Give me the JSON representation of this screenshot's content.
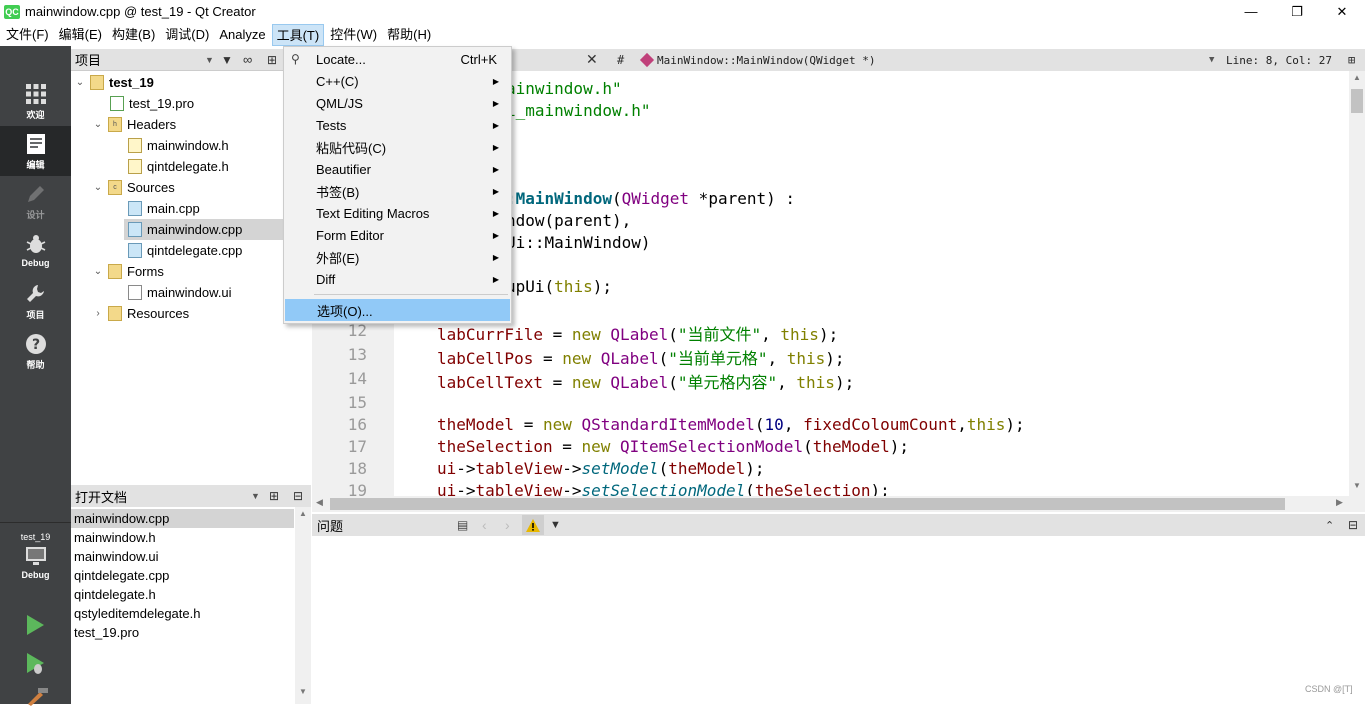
{
  "window": {
    "title": "mainwindow.cpp @ test_19 - Qt Creator",
    "app_icon": "QC"
  },
  "menubar": [
    "文件(F)",
    "编辑(E)",
    "构建(B)",
    "调试(D)",
    "Analyze",
    "工具(T)",
    "控件(W)",
    "帮助(H)"
  ],
  "modes": [
    {
      "label": "欢迎",
      "icon": "grid-icon"
    },
    {
      "label": "编辑",
      "icon": "edit-icon"
    },
    {
      "label": "设计",
      "icon": "pencil-icon"
    },
    {
      "label": "Debug",
      "icon": "bug-icon"
    },
    {
      "label": "项目",
      "icon": "wrench-icon"
    },
    {
      "label": "帮助",
      "icon": "help-icon"
    }
  ],
  "kit": {
    "project": "test_19",
    "mode": "Debug"
  },
  "project_panel": {
    "title": "项目",
    "tree": [
      {
        "label": "test_19",
        "level": 0,
        "bold": true,
        "type": "pro"
      },
      {
        "label": "test_19.pro",
        "level": 1,
        "type": "pro"
      },
      {
        "label": "Headers",
        "level": 1,
        "type": "folder-h"
      },
      {
        "label": "mainwindow.h",
        "level": 2,
        "type": "h"
      },
      {
        "label": "qintdelegate.h",
        "level": 2,
        "type": "h"
      },
      {
        "label": "Sources",
        "level": 1,
        "type": "folder-cpp"
      },
      {
        "label": "main.cpp",
        "level": 2,
        "type": "cpp"
      },
      {
        "label": "mainwindow.cpp",
        "level": 2,
        "type": "cpp",
        "selected": true
      },
      {
        "label": "qintdelegate.cpp",
        "level": 2,
        "type": "cpp"
      },
      {
        "label": "Forms",
        "level": 1,
        "type": "folder-ui"
      },
      {
        "label": "mainwindow.ui",
        "level": 2,
        "type": "ui"
      },
      {
        "label": "Resources",
        "level": 1,
        "type": "folder-res",
        "collapsed": true
      }
    ]
  },
  "open_docs": {
    "title": "打开文档",
    "items": [
      "mainwindow.cpp",
      "mainwindow.h",
      "mainwindow.ui",
      "qintdelegate.cpp",
      "qintdelegate.h",
      "qstyleditemdelegate.h",
      "test_19.pro"
    ]
  },
  "editor": {
    "symbol": "MainWindow::MainWindow(QWidget *)",
    "hash": "#",
    "position": "Line: 8, Col: 27",
    "visible_lines": [
      {
        "n": "",
        "segs": [
          [
            "st",
            "ainwindow.h\""
          ]
        ]
      },
      {
        "n": "",
        "segs": [
          [
            "st",
            "i_mainwindow.h\""
          ]
        ]
      },
      {
        "n": "",
        "segs": []
      },
      {
        "n": "",
        "segs": []
      },
      {
        "n": "",
        "segs": [
          [
            "fn",
            ":MainWindow"
          ],
          [
            "",
            "("
          ],
          [
            "ty",
            "QWidget"
          ],
          [
            "",
            " *parent) :"
          ]
        ]
      },
      {
        "n": "",
        "segs": [
          [
            "",
            "ndow(parent),"
          ]
        ]
      },
      {
        "n": "",
        "segs": [
          [
            "",
            "Ui::MainWindow)"
          ]
        ]
      },
      {
        "n": "",
        "segs": []
      },
      {
        "n": "",
        "segs": [
          [
            "",
            "upUi("
          ],
          [
            "kw",
            "this"
          ],
          [
            "",
            ");"
          ]
        ]
      },
      {
        "n": "",
        "segs": []
      },
      {
        "n": "12",
        "segs": [
          [
            "mem",
            "labCurrFile"
          ],
          [
            "",
            " = "
          ],
          [
            "kw",
            "new"
          ],
          [
            "",
            " "
          ],
          [
            "ty",
            "QLabel"
          ],
          [
            "",
            "("
          ],
          [
            "st",
            "\"当前文件\""
          ],
          [
            "",
            ", "
          ],
          [
            "kw",
            "this"
          ],
          [
            "",
            ");"
          ]
        ]
      },
      {
        "n": "13",
        "segs": [
          [
            "mem",
            "labCellPos"
          ],
          [
            "",
            " = "
          ],
          [
            "kw",
            "new"
          ],
          [
            "",
            " "
          ],
          [
            "ty",
            "QLabel"
          ],
          [
            "",
            "("
          ],
          [
            "st",
            "\"当前单元格\""
          ],
          [
            "",
            ", "
          ],
          [
            "kw",
            "this"
          ],
          [
            "",
            ");"
          ]
        ]
      },
      {
        "n": "14",
        "segs": [
          [
            "mem",
            "labCellText"
          ],
          [
            "",
            " = "
          ],
          [
            "kw",
            "new"
          ],
          [
            "",
            " "
          ],
          [
            "ty",
            "QLabel"
          ],
          [
            "",
            "("
          ],
          [
            "st",
            "\"单元格内容\""
          ],
          [
            "",
            ", "
          ],
          [
            "kw",
            "this"
          ],
          [
            "",
            ");"
          ]
        ]
      },
      {
        "n": "15",
        "segs": []
      },
      {
        "n": "16",
        "segs": [
          [
            "mem",
            "theModel"
          ],
          [
            "",
            " = "
          ],
          [
            "kw",
            "new"
          ],
          [
            "",
            " "
          ],
          [
            "ty",
            "QStandardItemModel"
          ],
          [
            "",
            "("
          ],
          [
            "num",
            "10"
          ],
          [
            "",
            ", "
          ],
          [
            "mem",
            "fixedColoumCount"
          ],
          [
            "",
            ","
          ],
          [
            "kw",
            "this"
          ],
          [
            "",
            ");"
          ]
        ]
      },
      {
        "n": "17",
        "segs": [
          [
            "mem",
            "theSelection"
          ],
          [
            "",
            " = "
          ],
          [
            "kw",
            "new"
          ],
          [
            "",
            " "
          ],
          [
            "ty",
            "QItemSelectionModel"
          ],
          [
            "",
            "("
          ],
          [
            "mem",
            "theModel"
          ],
          [
            "",
            ");"
          ]
        ]
      },
      {
        "n": "18",
        "segs": [
          [
            "mem",
            "ui"
          ],
          [
            "",
            "->"
          ],
          [
            "mem",
            "tableView"
          ],
          [
            "",
            "->"
          ],
          [
            "it",
            "setModel"
          ],
          [
            "",
            "("
          ],
          [
            "mem",
            "theModel"
          ],
          [
            "",
            ");"
          ]
        ]
      },
      {
        "n": "19",
        "segs": [
          [
            "mem",
            "ui"
          ],
          [
            "",
            "->"
          ],
          [
            "mem",
            "tableView"
          ],
          [
            "",
            "->"
          ],
          [
            "it",
            "setSelectionModel"
          ],
          [
            "",
            "("
          ],
          [
            "mem",
            "theSelection"
          ],
          [
            "",
            ");"
          ]
        ]
      }
    ]
  },
  "issues": {
    "title": "问题"
  },
  "tools_menu": {
    "items": [
      {
        "label": "Locate...",
        "shortcut": "Ctrl+K",
        "icon": "search-icon"
      },
      {
        "label": "C++(C)",
        "submenu": true
      },
      {
        "label": "QML/JS",
        "submenu": true
      },
      {
        "label": "Tests",
        "submenu": true
      },
      {
        "label": "粘贴代码(C)",
        "submenu": true
      },
      {
        "label": "Beautifier",
        "submenu": true
      },
      {
        "label": "书签(B)",
        "submenu": true
      },
      {
        "label": "Text Editing Macros",
        "submenu": true
      },
      {
        "label": "Form Editor",
        "submenu": true
      },
      {
        "label": "外部(E)",
        "submenu": true
      },
      {
        "label": "Diff",
        "submenu": true
      },
      {
        "label": "选项(O)...",
        "highlighted": true
      }
    ]
  },
  "watermark": "CSDN @[T]",
  "colors": {
    "sidebar": "#404244",
    "menu_highlight": "#91c9f7",
    "keyword": "#808000",
    "string": "#008000",
    "type": "#800080"
  }
}
